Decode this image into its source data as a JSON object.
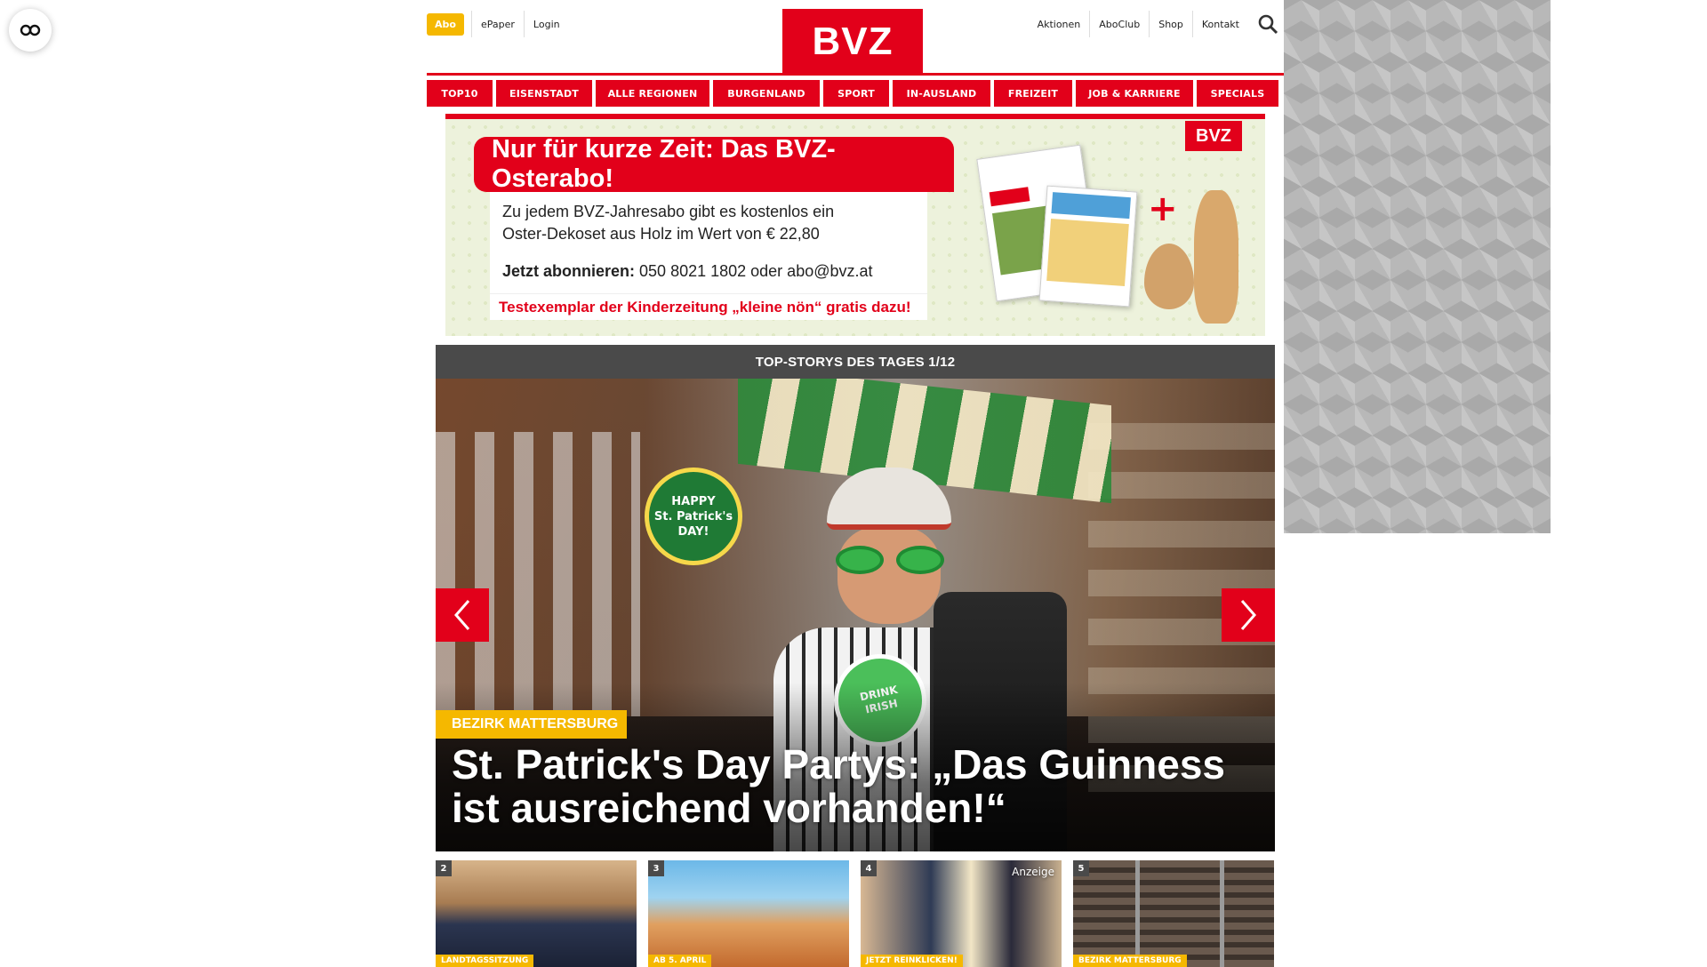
{
  "accessibility": {
    "icon": "glasses-icon"
  },
  "header": {
    "abo_label": "Abo",
    "left_links": [
      "ePaper",
      "Login"
    ],
    "right_links": [
      "Aktionen",
      "AboClub",
      "Shop",
      "Kontakt"
    ],
    "logo_text": "BVZ",
    "brand_color": "#e2001a",
    "accent_color": "#f5b800"
  },
  "nav": {
    "items": [
      "TOP10",
      "EISENSTADT",
      "ALLE REGIONEN",
      "BURGENLAND",
      "SPORT",
      "IN-AUSLAND",
      "FREIZEIT",
      "JOB & KARRIERE",
      "SPECIALS"
    ]
  },
  "ad": {
    "headline": "Nur für kurze Zeit: Das BVZ-Osterabo!",
    "line1": "Zu jedem BVZ-Jahresabo gibt es kostenlos ein",
    "line2": "Oster-Dekoset aus Holz im Wert von € 22,80",
    "contact_label": "Jetzt abonnieren:",
    "contact_value": " 050 8021 1802 oder abo@bvz.at",
    "sub": "Testexemplar der Kinderzeitung „kleine nön“ gratis dazu!",
    "logo": "BVZ",
    "plus": "+"
  },
  "stories": {
    "header": "TOP-STORYS DES TAGES 1/12",
    "hero": {
      "tag": "BEZIRK MATTERSBURG",
      "title": "St. Patrick's Day Partys: „Das Guinness ist ausreichend vorhanden!“"
    },
    "thumbs": [
      {
        "num": "2",
        "tag": "LANDTAGSSITZUNG"
      },
      {
        "num": "3",
        "tag": "AB 5. APRIL"
      },
      {
        "num": "4",
        "tag": "JETZT REINKLICKEN!",
        "extra": "Anzeige"
      },
      {
        "num": "5",
        "tag": "BEZIRK MATTERSBURG"
      }
    ]
  }
}
